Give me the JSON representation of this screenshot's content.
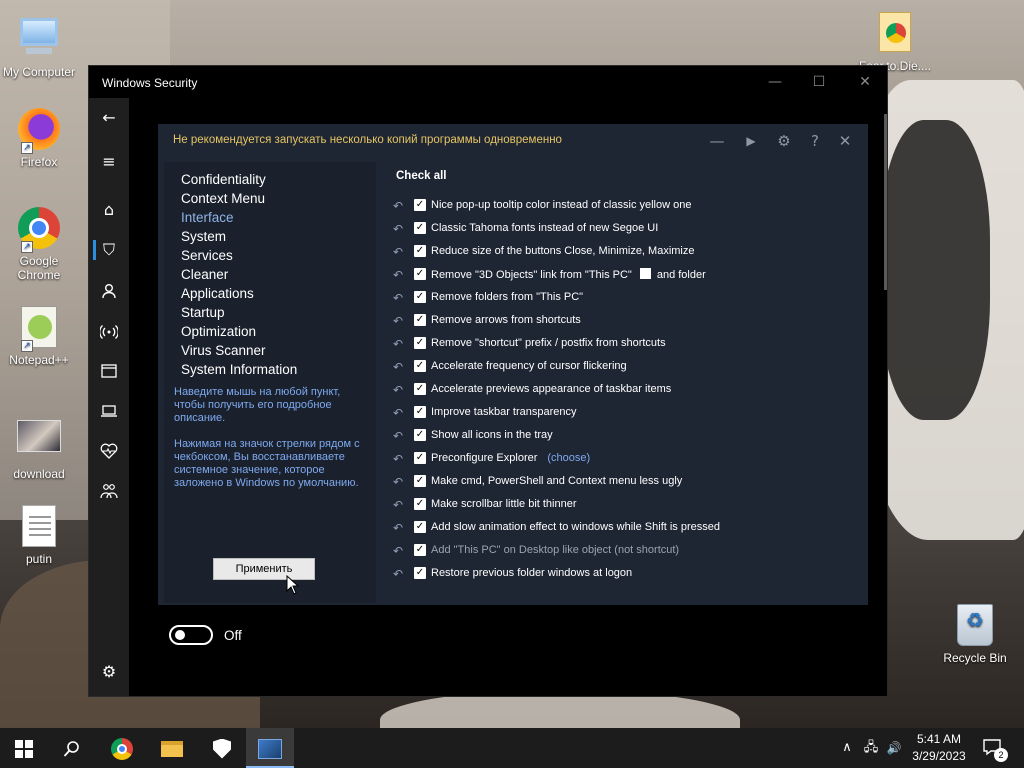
{
  "desktop": {
    "icons": [
      {
        "label": "My Computer"
      },
      {
        "label": "Firefox"
      },
      {
        "label": "Google Chrome"
      },
      {
        "label": "Notepad++"
      },
      {
        "label": "download"
      },
      {
        "label": "putin"
      },
      {
        "label": "Fear.to.Die...."
      },
      {
        "label": "Recycle Bin"
      }
    ]
  },
  "window": {
    "title": "Windows Security",
    "controls": {
      "minimize": "—",
      "maximize": "☐",
      "close": "✕"
    },
    "sidebar_icons": [
      "back-arrow",
      "hamburger-menu",
      "home",
      "shield",
      "person",
      "wireless",
      "app-browser",
      "laptop",
      "heart-pulse",
      "family",
      "gear"
    ]
  },
  "panel": {
    "warning": "Не рекомендуется запускать несколько копий программы одновременно",
    "header_controls": {
      "minimize": "—",
      "play": "▶",
      "settings": "⚙",
      "help": "?",
      "close": "✕"
    },
    "nav": [
      {
        "label": "Confidentiality"
      },
      {
        "label": "Context Menu"
      },
      {
        "label": "Interface"
      },
      {
        "label": "System"
      },
      {
        "label": "Services"
      },
      {
        "label": "Cleaner"
      },
      {
        "label": "Applications"
      },
      {
        "label": "Startup"
      },
      {
        "label": "Optimization"
      },
      {
        "label": "Virus Scanner"
      },
      {
        "label": "System Information"
      }
    ],
    "active_nav": "Interface",
    "hint1": "Наведите мышь на любой пункт, чтобы получить его подробное описание.",
    "hint2": "Нажимая на значок стрелки рядом с чекбоксом, Вы восстанавливаете системное значение, которое заложено в Windows по умолчанию.",
    "apply_label": "Применить",
    "check_all": "Check all",
    "options": [
      {
        "label": "Nice pop-up tooltip color instead of classic yellow one",
        "checked": true
      },
      {
        "label": "Classic Tahoma fonts instead of new Segoe UI",
        "checked": true
      },
      {
        "label": "Reduce size of the buttons Close, Minimize, Maximize",
        "checked": true
      },
      {
        "label": "Remove \"3D Objects\" link from \"This PC\"",
        "checked": true,
        "suffix": "and folder"
      },
      {
        "label": "Remove folders from \"This PC\"",
        "checked": true
      },
      {
        "label": "Remove arrows from shortcuts",
        "checked": true
      },
      {
        "label": "Remove \"shortcut\" prefix / postfix from shortcuts",
        "checked": true
      },
      {
        "label": "Accelerate frequency of cursor flickering",
        "checked": true
      },
      {
        "label": "Accelerate previews appearance of taskbar items",
        "checked": true
      },
      {
        "label": "Improve taskbar transparency",
        "checked": true
      },
      {
        "label": "Show all icons in the tray",
        "checked": true
      },
      {
        "label": "Preconfigure Explorer",
        "checked": true,
        "link": "(choose)"
      },
      {
        "label": "Make cmd, PowerShell and Context menu less ugly",
        "checked": true
      },
      {
        "label": "Make scrollbar little bit thinner",
        "checked": true
      },
      {
        "label": "Add slow animation effect to windows while Shift is pressed",
        "checked": true
      },
      {
        "label": "Add \"This PC\" on Desktop like object (not shortcut)",
        "checked": true,
        "dim": true
      },
      {
        "label": "Restore previous folder windows at logon",
        "checked": true
      }
    ]
  },
  "toggle": {
    "label": "Off",
    "state": "off"
  },
  "taskbar": {
    "time": "5:41 AM",
    "date": "3/29/2023",
    "notification_count": "2",
    "tray": {
      "chevron": "∧",
      "network": "🖧",
      "volume": "🔊"
    }
  },
  "colors": {
    "accent": "#2d8fe0",
    "warning": "#e6c564",
    "link": "#7eaaf0",
    "panel_bg": "#1e2533"
  }
}
